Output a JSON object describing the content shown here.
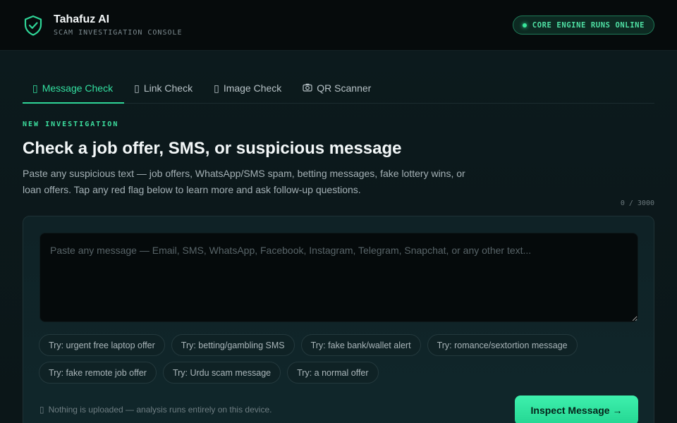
{
  "app": {
    "name": "Tahafuz AI",
    "subtitle": "SCAM INVESTIGATION CONSOLE",
    "status": "CORE ENGINE RUNS ONLINE",
    "accent": "#2fd597"
  },
  "tabs": [
    {
      "label": "Message Check",
      "icon": "message-icon",
      "glyph": "▯",
      "active": true
    },
    {
      "label": "Link Check",
      "icon": "link-icon",
      "glyph": "▯",
      "active": false
    },
    {
      "label": "Image Check",
      "icon": "image-icon",
      "glyph": "▯",
      "active": false
    },
    {
      "label": "QR Scanner",
      "icon": "camera-icon",
      "glyph": "📷",
      "active": false
    }
  ],
  "section": {
    "eyebrow": "NEW INVESTIGATION",
    "title": "Check a job offer, SMS, or suspicious message",
    "description": "Paste any suspicious text — job offers, WhatsApp/SMS spam, betting messages, fake lottery wins, or loan offers. Tap any red flag below to learn more and ask follow-up questions.",
    "counter": "0 / 3000"
  },
  "input": {
    "value": "",
    "placeholder": "Paste any message — Email, SMS, WhatsApp, Facebook, Instagram, Telegram, Snapchat, or any other text..."
  },
  "samples": [
    "Try: urgent free laptop offer",
    "Try: betting/gambling SMS",
    "Try: fake bank/wallet alert",
    "Try: romance/sextortion message",
    "Try: fake remote job offer",
    "Try: Urdu scam message",
    "Try: a normal offer"
  ],
  "footer": {
    "privacy_glyph": "▯",
    "privacy": "Nothing is uploaded — analysis runs entirely on this device.",
    "inspect_label": "Inspect Message →"
  }
}
